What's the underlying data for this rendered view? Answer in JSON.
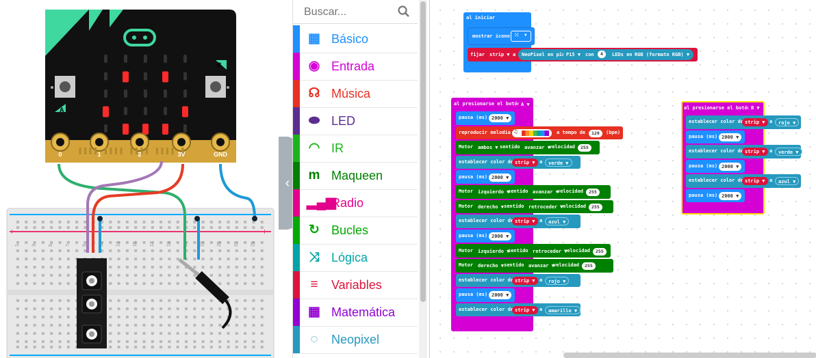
{
  "simulator": {
    "pin_labels": [
      "0",
      "1",
      "2",
      "3V",
      "GND"
    ],
    "button_labels": [
      "A",
      "B"
    ],
    "breadboard_numbers": [
      "1",
      "3",
      "5",
      "7",
      "9",
      "11",
      "13",
      "15",
      "17",
      "19",
      "21",
      "23",
      "25",
      "27",
      "29"
    ]
  },
  "toolbox": {
    "search_placeholder": "Buscar...",
    "categories": [
      {
        "label": "Básico",
        "color": "#1e90ff",
        "icon": "grid-icon"
      },
      {
        "label": "Entrada",
        "color": "#d400d4",
        "icon": "circle-dot-icon"
      },
      {
        "label": "Música",
        "color": "#e63022",
        "icon": "headphones-icon"
      },
      {
        "label": "LED",
        "color": "#5c2d91",
        "icon": "toggle-icon"
      },
      {
        "label": "IR",
        "color": "#1ab41a",
        "icon": "wifi-icon"
      },
      {
        "label": "Maqueen",
        "color": "#008000",
        "icon": "m-icon"
      },
      {
        "label": "Radio",
        "color": "#e3008c",
        "icon": "signal-bars-icon"
      },
      {
        "label": "Bucles",
        "color": "#00aa00",
        "icon": "refresh-icon"
      },
      {
        "label": "Lógica",
        "color": "#00a4a6",
        "icon": "shuffle-icon"
      },
      {
        "label": "Variables",
        "color": "#dc143c",
        "icon": "lines-icon"
      },
      {
        "label": "Matemática",
        "color": "#9400d3",
        "icon": "calculator-icon"
      },
      {
        "label": "Neopixel",
        "color": "#2699bf",
        "icon": "dotted-circle-icon"
      }
    ]
  },
  "workspace": {
    "start": {
      "hat": "al iniciar",
      "show_icon": "mostrar ícono",
      "set_strip": {
        "k1": "fijar",
        "var": "strip",
        "k2": "a",
        "k3": "NeoPixel en pin",
        "pin": "P15",
        "k4": "con",
        "count": "4",
        "k5": "LEDs en",
        "mode": "RGB (formato RGB)"
      }
    },
    "button_a": {
      "hat": "al presionarse el botón",
      "btn": "A",
      "rows": [
        {
          "kind": "pause",
          "label": "pausa (ms)",
          "v": "2000"
        },
        {
          "kind": "melody",
          "label": "reproducir melodía",
          "mid": "a tempo de",
          "v": "120",
          "unit": "(bpm)"
        },
        {
          "kind": "motor",
          "label": "Motor",
          "m": "ambos",
          "k": "sentido",
          "d": "avanzar",
          "s": "velocidad",
          "v": "255"
        },
        {
          "kind": "color",
          "label": "establecer color de",
          "var": "strip",
          "a": "a",
          "c": "verde"
        },
        {
          "kind": "pause",
          "label": "pausa (ms)",
          "v": "2000"
        },
        {
          "kind": "motor",
          "label": "Motor",
          "m": "izquierdo",
          "k": "sentido",
          "d": "avanzar",
          "s": "velocidad",
          "v": "255"
        },
        {
          "kind": "motor",
          "label": "Motor",
          "m": "derecho",
          "k": "sentido",
          "d": "retroceder",
          "s": "velocidad",
          "v": "255"
        },
        {
          "kind": "color",
          "label": "establecer color de",
          "var": "strip",
          "a": "a",
          "c": "azul"
        },
        {
          "kind": "pause",
          "label": "pausa (ms)",
          "v": "2000"
        },
        {
          "kind": "motor",
          "label": "Motor",
          "m": "izquierdo",
          "k": "sentido",
          "d": "retroceder",
          "s": "velocidad",
          "v": "255"
        },
        {
          "kind": "motor",
          "label": "Motor",
          "m": "derecho",
          "k": "sentido",
          "d": "avanzar",
          "s": "velocidad",
          "v": "255"
        },
        {
          "kind": "color",
          "label": "establecer color de",
          "var": "strip",
          "a": "a",
          "c": "rojo"
        },
        {
          "kind": "pause",
          "label": "pausa (ms)",
          "v": "2000"
        },
        {
          "kind": "color",
          "label": "establecer color de",
          "var": "strip",
          "a": "a",
          "c": "amarillo"
        }
      ]
    },
    "button_b": {
      "hat": "al presionarse el botón",
      "btn": "B",
      "rows": [
        {
          "kind": "color",
          "label": "establecer color de",
          "var": "strip",
          "a": "a",
          "c": "rojo"
        },
        {
          "kind": "pause",
          "label": "pausa (ms)",
          "v": "2000"
        },
        {
          "kind": "color",
          "label": "establecer color de",
          "var": "strip",
          "a": "a",
          "c": "verde"
        },
        {
          "kind": "pause",
          "label": "pausa (ms)",
          "v": "2000"
        },
        {
          "kind": "color",
          "label": "establecer color de",
          "var": "strip",
          "a": "a",
          "c": "azul"
        },
        {
          "kind": "pause",
          "label": "pausa (ms)",
          "v": "2000"
        }
      ]
    }
  }
}
